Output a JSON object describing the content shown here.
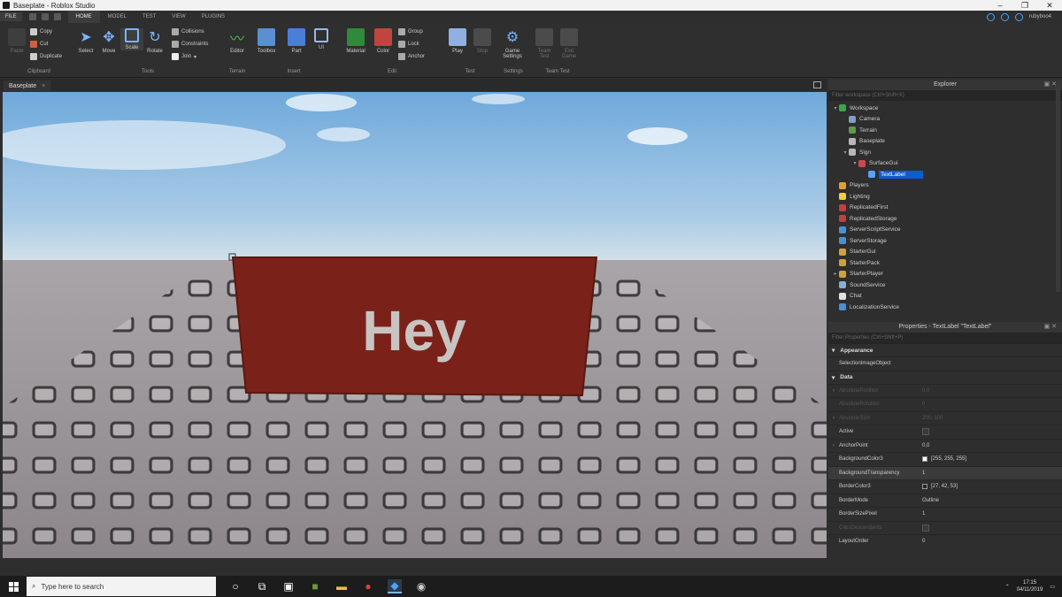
{
  "window": {
    "title": "Baseplate - Roblox Studio",
    "minimize": "–",
    "restore": "❐",
    "close": "✕"
  },
  "menubar": {
    "file": "FILE",
    "tabs": [
      "HOME",
      "MODEL",
      "TEST",
      "VIEW",
      "PLUGINS"
    ],
    "active_tab": "HOME",
    "username": "rubyboo4"
  },
  "ribbon": {
    "clipboard": {
      "label": "Clipboard",
      "paste": "Paste",
      "copy": "Copy",
      "cut": "Cut",
      "duplicate": "Duplicate"
    },
    "tools": {
      "label": "Tools",
      "select": "Select",
      "move": "Move",
      "scale": "Scale",
      "rotate": "Rotate",
      "collisions": "Collisions",
      "constraints": "Constraints",
      "join": "Join"
    },
    "terrain": {
      "label": "Terrain",
      "editor": "Editor"
    },
    "insert": {
      "label": "Insert",
      "toolbox": "Toolbox",
      "part": "Part",
      "ui": "UI"
    },
    "edit": {
      "label": "Edit",
      "material": "Material",
      "color": "Color",
      "group": "Group",
      "lock": "Lock",
      "anchor": "Anchor"
    },
    "test": {
      "label": "Test",
      "play": "Play",
      "stop": "Stop"
    },
    "settings": {
      "label": "Settings",
      "game_settings_1": "Game",
      "game_settings_2": "Settings"
    },
    "team_test": {
      "label": "Team Test",
      "team_1": "Team",
      "team_2": "Test",
      "exit_1": "Exit",
      "exit_2": "Game"
    }
  },
  "doc_tab": {
    "name": "Baseplate",
    "close": "×"
  },
  "viewport": {
    "sign_text": "Hey",
    "sign_color": "#7a2219"
  },
  "explorer": {
    "title": "Explorer",
    "filter_placeholder": "Filter workspace (Ctrl+Shift+X)",
    "items": [
      {
        "label": "Workspace",
        "depth": 0,
        "arrow": "▾",
        "icon": "globe-icon",
        "color": "#3fa34d"
      },
      {
        "label": "Camera",
        "depth": 1,
        "arrow": "",
        "icon": "camera-icon",
        "color": "#7f9fbf"
      },
      {
        "label": "Terrain",
        "depth": 1,
        "arrow": "",
        "icon": "terrain-icon",
        "color": "#5c9c4a"
      },
      {
        "label": "Baseplate",
        "depth": 1,
        "arrow": "",
        "icon": "part-icon",
        "color": "#b8b8b8"
      },
      {
        "label": "Sign",
        "depth": 1,
        "arrow": "▾",
        "icon": "part-icon",
        "color": "#b8b8b8"
      },
      {
        "label": "SurfaceGui",
        "depth": 2,
        "arrow": "▾",
        "icon": "surfacegui-icon",
        "color": "#d04848"
      },
      {
        "label": "TextLabel",
        "depth": 3,
        "arrow": "",
        "icon": "textlabel-icon",
        "color": "#5aa0ff",
        "selected": true
      },
      {
        "label": "Players",
        "depth": 0,
        "arrow": "",
        "icon": "players-icon",
        "color": "#e0a030"
      },
      {
        "label": "Lighting",
        "depth": 0,
        "arrow": "",
        "icon": "lighting-icon",
        "color": "#f0d040"
      },
      {
        "label": "ReplicatedFirst",
        "depth": 0,
        "arrow": "",
        "icon": "replicated-first-icon",
        "color": "#c04040"
      },
      {
        "label": "ReplicatedStorage",
        "depth": 0,
        "arrow": "",
        "icon": "replicated-storage-icon",
        "color": "#c04040"
      },
      {
        "label": "ServerScriptService",
        "depth": 0,
        "arrow": "",
        "icon": "server-script-icon",
        "color": "#4a90d0"
      },
      {
        "label": "ServerStorage",
        "depth": 0,
        "arrow": "",
        "icon": "server-storage-icon",
        "color": "#4a90d0"
      },
      {
        "label": "StarterGui",
        "depth": 0,
        "arrow": "",
        "icon": "starter-gui-icon",
        "color": "#d0a040"
      },
      {
        "label": "StarterPack",
        "depth": 0,
        "arrow": "",
        "icon": "starter-pack-icon",
        "color": "#d0a040"
      },
      {
        "label": "StarterPlayer",
        "depth": 0,
        "arrow": "▸",
        "icon": "starter-player-icon",
        "color": "#d0a040"
      },
      {
        "label": "SoundService",
        "depth": 0,
        "arrow": "",
        "icon": "sound-icon",
        "color": "#8ab0d0"
      },
      {
        "label": "Chat",
        "depth": 0,
        "arrow": "",
        "icon": "chat-icon",
        "color": "#e0e0e0"
      },
      {
        "label": "LocalizationService",
        "depth": 0,
        "arrow": "",
        "icon": "localization-icon",
        "color": "#4a90d0"
      }
    ]
  },
  "properties": {
    "title": "Properties - TextLabel \"TextLabel\"",
    "filter_placeholder": "Filter Properties (Ctrl+Shift+P)",
    "sections": {
      "appearance": "Appearance",
      "data": "Data"
    },
    "appearance_rows": [
      {
        "name": "SelectionImageObject",
        "value": ""
      }
    ],
    "data_rows": [
      {
        "name": "AbsolutePosition",
        "value": "0,0",
        "faded": true,
        "arrow": "›"
      },
      {
        "name": "AbsoluteRotation",
        "value": "0",
        "faded": true,
        "arrow": ""
      },
      {
        "name": "AbsoluteSize",
        "value": "200, 100",
        "faded": true,
        "arrow": "›"
      },
      {
        "name": "Active",
        "value": "",
        "checkbox": true,
        "arrow": ""
      },
      {
        "name": "AnchorPoint",
        "value": "0,0",
        "arrow": "›"
      },
      {
        "name": "BackgroundColor3",
        "value": "[255, 255, 255]",
        "swatch": "#ffffff",
        "arrow": ""
      },
      {
        "name": "BackgroundTransparency",
        "value": "1",
        "highlight": true,
        "arrow": ""
      },
      {
        "name": "BorderColor3",
        "value": "[27, 42, 53]",
        "swatch": "#1b2a35",
        "arrow": ""
      },
      {
        "name": "BorderMode",
        "value": "Outline",
        "arrow": ""
      },
      {
        "name": "BorderSizePixel",
        "value": "1",
        "arrow": ""
      },
      {
        "name": "ClipsDescendants",
        "value": "",
        "faded": true,
        "checkbox": true,
        "arrow": ""
      },
      {
        "name": "LayoutOrder",
        "value": "0",
        "arrow": ""
      }
    ]
  },
  "taskbar": {
    "search_placeholder": "Type here to search",
    "time": "17:15",
    "date": "04/11/2019"
  }
}
